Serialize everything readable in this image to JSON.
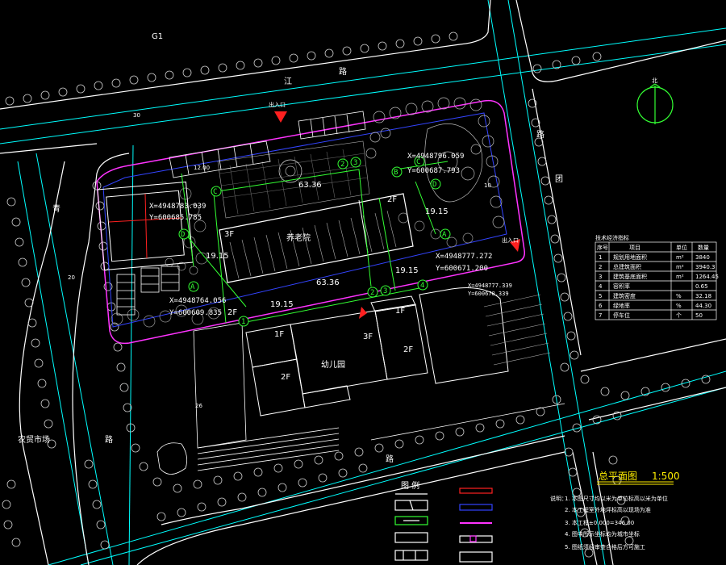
{
  "labels": {
    "g1": "G1",
    "road_top": "路",
    "road_top_name": "江",
    "road_left": "青",
    "road_left2": "路",
    "road_right": "路",
    "road_right_name": "团",
    "road_bottom": "路",
    "market": "农贸市场",
    "exit_label": "出入口",
    "exit_label_right": "出入口",
    "north": "北"
  },
  "buildings": {
    "main_name": "养老院",
    "main_floor_left": "3F",
    "main_floor_right": "2F",
    "kinder_name": "幼儿园",
    "k_1f_a": "1F",
    "k_3f": "3F",
    "k_2f_a": "2F",
    "k_1f_b": "1F",
    "k_2f_b": "2F",
    "k_2f_c": "2F"
  },
  "dimensions": {
    "top_len": "63.36",
    "bottom_len": "63.36",
    "left_w": "19.15",
    "mid_w1": "19.15",
    "mid_w2": "19.15",
    "right_w": "19.15",
    "d12": "12.00",
    "d10": "10",
    "d26": "26",
    "d20": "20",
    "d30": "30"
  },
  "coords": {
    "c1x": "X=4948783.039",
    "c1y": "Y=600685.785",
    "c2x": "X=4948764.056",
    "c2y": "Y=600609.835",
    "c3x": "X=4948796.059",
    "c3y": "Y=600687.793",
    "c4x": "X=4948777.272",
    "c4y": "Y=600671.200",
    "c5x": "X=4948777.339",
    "c5y": "Y=600670.339"
  },
  "markers": [
    "A",
    "B",
    "C",
    "D",
    "1",
    "2",
    "3",
    "4"
  ],
  "title": {
    "name": "总平面图",
    "scale": "1:500"
  },
  "legend": {
    "title": "图 例"
  },
  "notes": {
    "head": "说明：",
    "n1": "1. 本图尺寸均以米为单位标高以米为单位",
    "n2": "2. 本工程室外地坪标高以现场为准",
    "n3": "3. 本工程±0.000=346.00",
    "n4": "4. 图中所示坐标均为城市坐标",
    "n5": "5. 图纸须经审查合格后方可施工"
  },
  "table": {
    "title": "技术经济指标",
    "headers": [
      "序号",
      "项目",
      "单位",
      "数量"
    ],
    "rows": [
      [
        "1",
        "规划用地面积",
        "m²",
        "3840"
      ],
      [
        "2",
        "总建筑面积",
        "m²",
        "3940.3"
      ],
      [
        "3",
        "建筑基底面积",
        "m²",
        "1264.45"
      ],
      [
        "4",
        "容积率",
        "",
        "0.65"
      ],
      [
        "5",
        "建筑密度",
        "%",
        "32.18"
      ],
      [
        "6",
        "绿地率",
        "%",
        "44.30"
      ],
      [
        "7",
        "停车位",
        "个",
        "50"
      ]
    ]
  },
  "colors": {
    "background": "#000000",
    "road_line": "#00ffff",
    "site_boundary": "#ff33ff",
    "green_line": "#33ff33",
    "red_line": "#ff2020",
    "blue_line": "#3333ff",
    "title_yellow": "#ffee00",
    "linework": "#ffffff"
  }
}
